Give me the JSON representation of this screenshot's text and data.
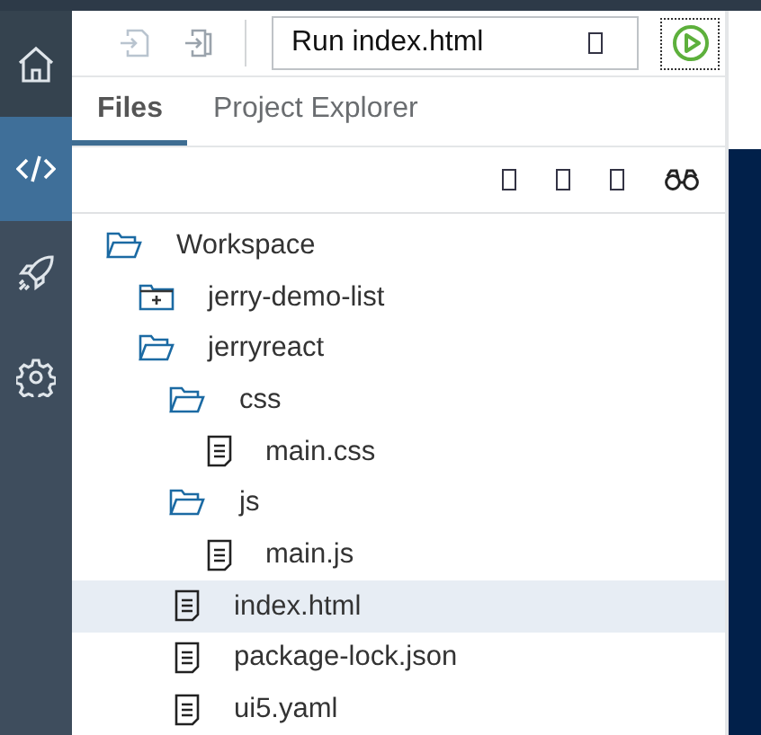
{
  "rail": [
    {
      "selected": false
    },
    {
      "selected": true
    },
    {
      "selected": false
    },
    {
      "selected": false
    }
  ],
  "toolbar": {
    "run_field": {
      "value": "Run index.html"
    }
  },
  "tabs": [
    {
      "label": "Files",
      "selected": true
    },
    {
      "label": "Project Explorer",
      "selected": false
    }
  ],
  "tree": [
    {
      "label": "Workspace",
      "kind": "folder",
      "expanded": true,
      "selected": false,
      "children": [
        {
          "label": "jerry-demo-list",
          "kind": "folder",
          "expanded": false,
          "selected": false
        },
        {
          "label": "jerryreact",
          "kind": "folder",
          "expanded": true,
          "selected": false,
          "children": [
            {
              "label": "css",
              "kind": "folder",
              "expanded": true,
              "selected": false,
              "children": [
                {
                  "label": "main.css",
                  "kind": "file",
                  "selected": false
                }
              ]
            },
            {
              "label": "js",
              "kind": "folder",
              "expanded": true,
              "selected": false,
              "children": [
                {
                  "label": "main.js",
                  "kind": "file",
                  "selected": false
                }
              ]
            },
            {
              "label": "index.html",
              "kind": "file",
              "selected": true
            },
            {
              "label": "package-lock.json",
              "kind": "file",
              "selected": false
            },
            {
              "label": "ui5.yaml",
              "kind": "file",
              "selected": false
            }
          ]
        }
      ]
    }
  ]
}
